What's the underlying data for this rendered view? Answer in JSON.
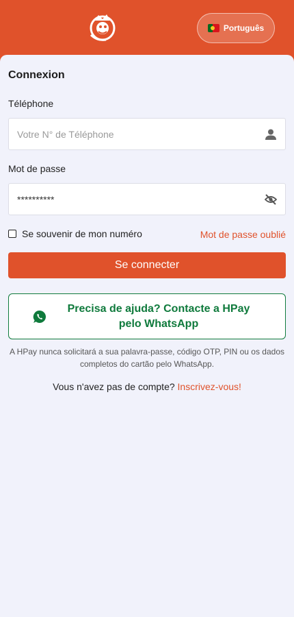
{
  "header": {
    "language": "Português",
    "brand_color": "#e0522b"
  },
  "form": {
    "title": "Connexion",
    "phone": {
      "label": "Téléphone",
      "placeholder": "Votre N° de Téléphone",
      "value": ""
    },
    "password": {
      "label": "Mot de passe",
      "value": "**********"
    },
    "remember_label": "Se souvenir de mon numéro",
    "forgot_label": "Mot de passe oublié",
    "submit_label": "Se connecter"
  },
  "help": {
    "whatsapp_label": "Precisa de ajuda? Contacte a HPay pelo WhatsApp",
    "whatsapp_color": "#0f7a3c",
    "disclaimer": "A HPay nunca solicitará a sua palavra-passe, código OTP, PIN ou os dados completos do cartão pelo WhatsApp."
  },
  "signup": {
    "prompt": "Vous n'avez pas de compte?",
    "link": "Inscrivez-vous!"
  },
  "icons": {
    "logo": "mascot-logo",
    "phone_field": "user-icon",
    "password_field": "eye-off-icon",
    "help": "whatsapp-icon"
  }
}
